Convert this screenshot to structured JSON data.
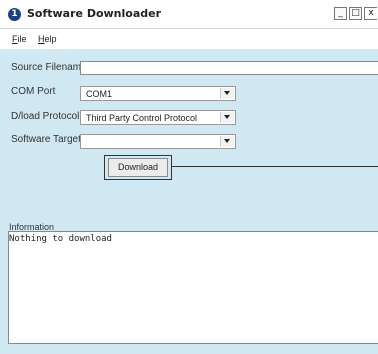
{
  "window": {
    "title": "Software Downloader",
    "icon_glyph": "1",
    "controls": {
      "minimize": "_",
      "maximize": "□",
      "close": "x"
    }
  },
  "menu": {
    "file_u": "F",
    "file_rest": "ile",
    "help_u": "H",
    "help_rest": "elp"
  },
  "form": {
    "source_label": "Source Filename",
    "source_value": "",
    "com_port_label": "COM Port",
    "com_port_value": "COM1",
    "protocol_label": "D/load Protocol",
    "protocol_value": "Third Party Control Protocol",
    "target_label": "Software Target",
    "target_value": ""
  },
  "download_button": "Download",
  "information": {
    "label": "Information",
    "text": "Nothing to download"
  }
}
